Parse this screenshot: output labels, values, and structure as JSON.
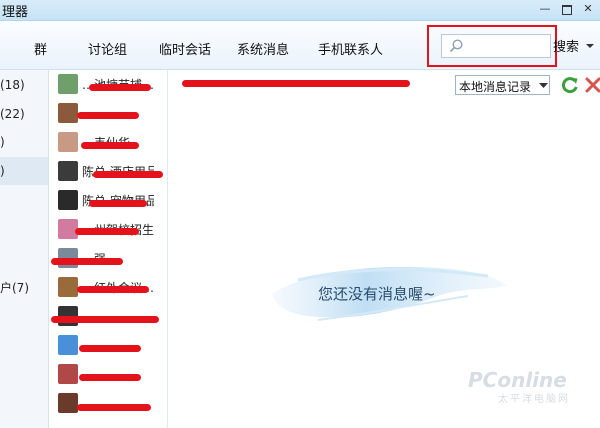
{
  "window": {
    "title": "理器"
  },
  "tabs": [
    {
      "label": "群"
    },
    {
      "label": "讨论组"
    },
    {
      "label": "临时会话"
    },
    {
      "label": "系统消息"
    },
    {
      "label": "手机联系人"
    }
  ],
  "search": {
    "placeholder": "",
    "button_label": "搜索"
  },
  "groups": [
    {
      "label": "(18)"
    },
    {
      "label": "(22)"
    },
    {
      "label": ")"
    },
    {
      "label": ")"
    },
    {
      "label": "户(7)"
    }
  ],
  "contacts": [
    {
      "name": "…池塘苗捕…",
      "avatar_color": "#6fa06b"
    },
    {
      "name": "",
      "avatar_color": "#8b5a3c"
    },
    {
      "name": "…韦仙华",
      "avatar_color": "#c89a86"
    },
    {
      "name": "陈总 酒店用品",
      "avatar_color": "#3b3b3b"
    },
    {
      "name": "陈总 宠物用品",
      "avatar_color": "#2a2a2a"
    },
    {
      "name": "…州驾校招生主任",
      "avatar_color": "#d27aa0"
    },
    {
      "name": "…强",
      "avatar_color": "#7a8a9a"
    },
    {
      "name": "…红外会议…",
      "avatar_color": "#9a6b3a"
    },
    {
      "name": "",
      "avatar_color": "#333333"
    },
    {
      "name": "…",
      "avatar_color": "#4a90d9"
    },
    {
      "name": "…",
      "avatar_color": "#b04848"
    },
    {
      "name": "…",
      "avatar_color": "#6a3a2a"
    }
  ],
  "main": {
    "history_dropdown": "本地消息记录",
    "empty_message": "您还没有消息喔~"
  },
  "watermark": {
    "main": "PConline",
    "sub": "太平洋电脑网"
  },
  "colors": {
    "redaction": "#e4121a",
    "highlight_box": "#e3121c",
    "refresh": "#3aa13a",
    "delete": "#d9534f"
  }
}
